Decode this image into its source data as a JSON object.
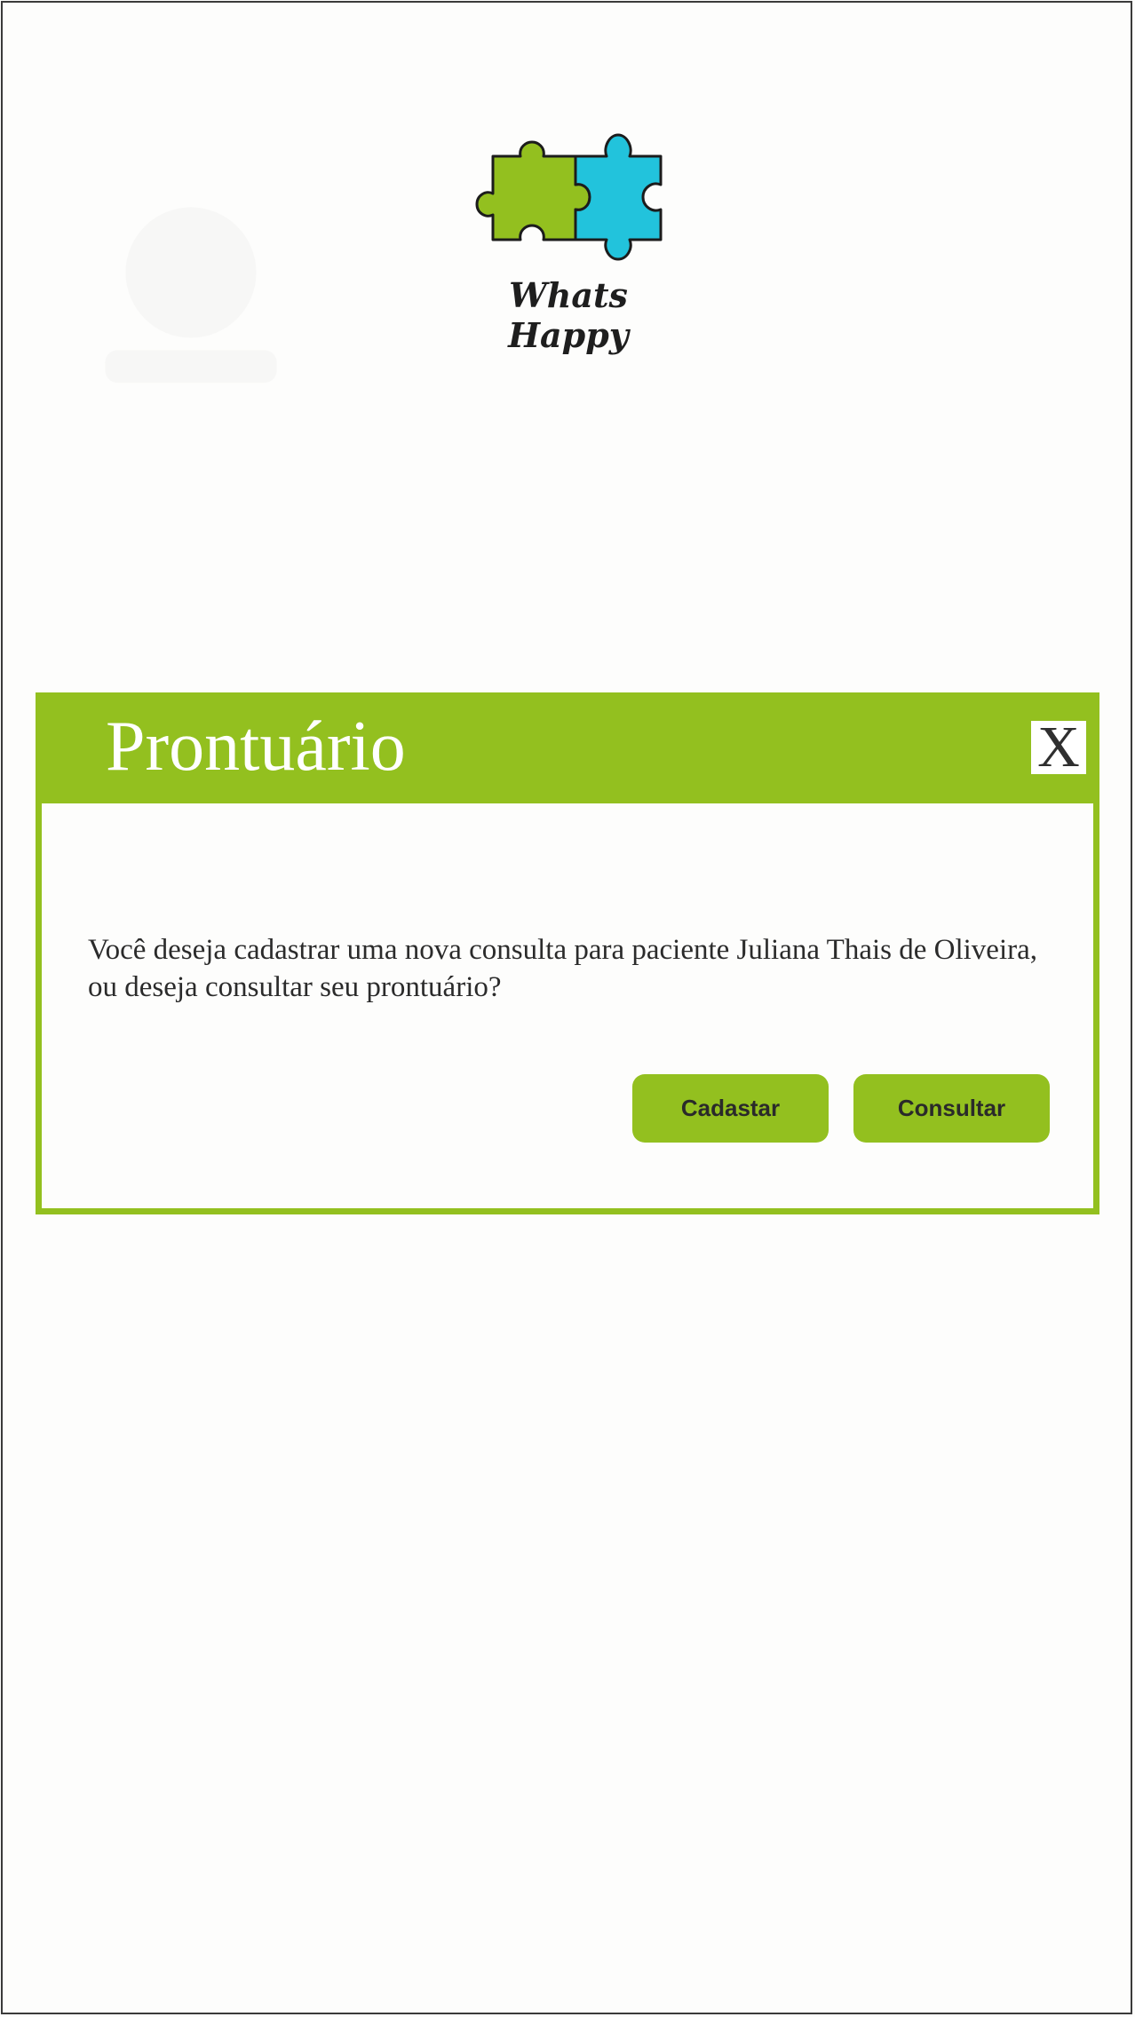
{
  "app": {
    "brand_name": "Whats Happy",
    "logo_icon": "puzzle-pieces-icon",
    "colors": {
      "accent": "#93c01f",
      "secondary": "#22c3dc",
      "text": "#2b2b2b"
    }
  },
  "dialog": {
    "title": "Prontuário",
    "close_label": "X",
    "message": "Você deseja cadastrar uma nova consulta para paciente Juliana Thais de Oliveira, ou deseja consultar seu prontuário?",
    "buttons": {
      "primary_label": "Cadastar",
      "secondary_label": "Consultar"
    }
  }
}
